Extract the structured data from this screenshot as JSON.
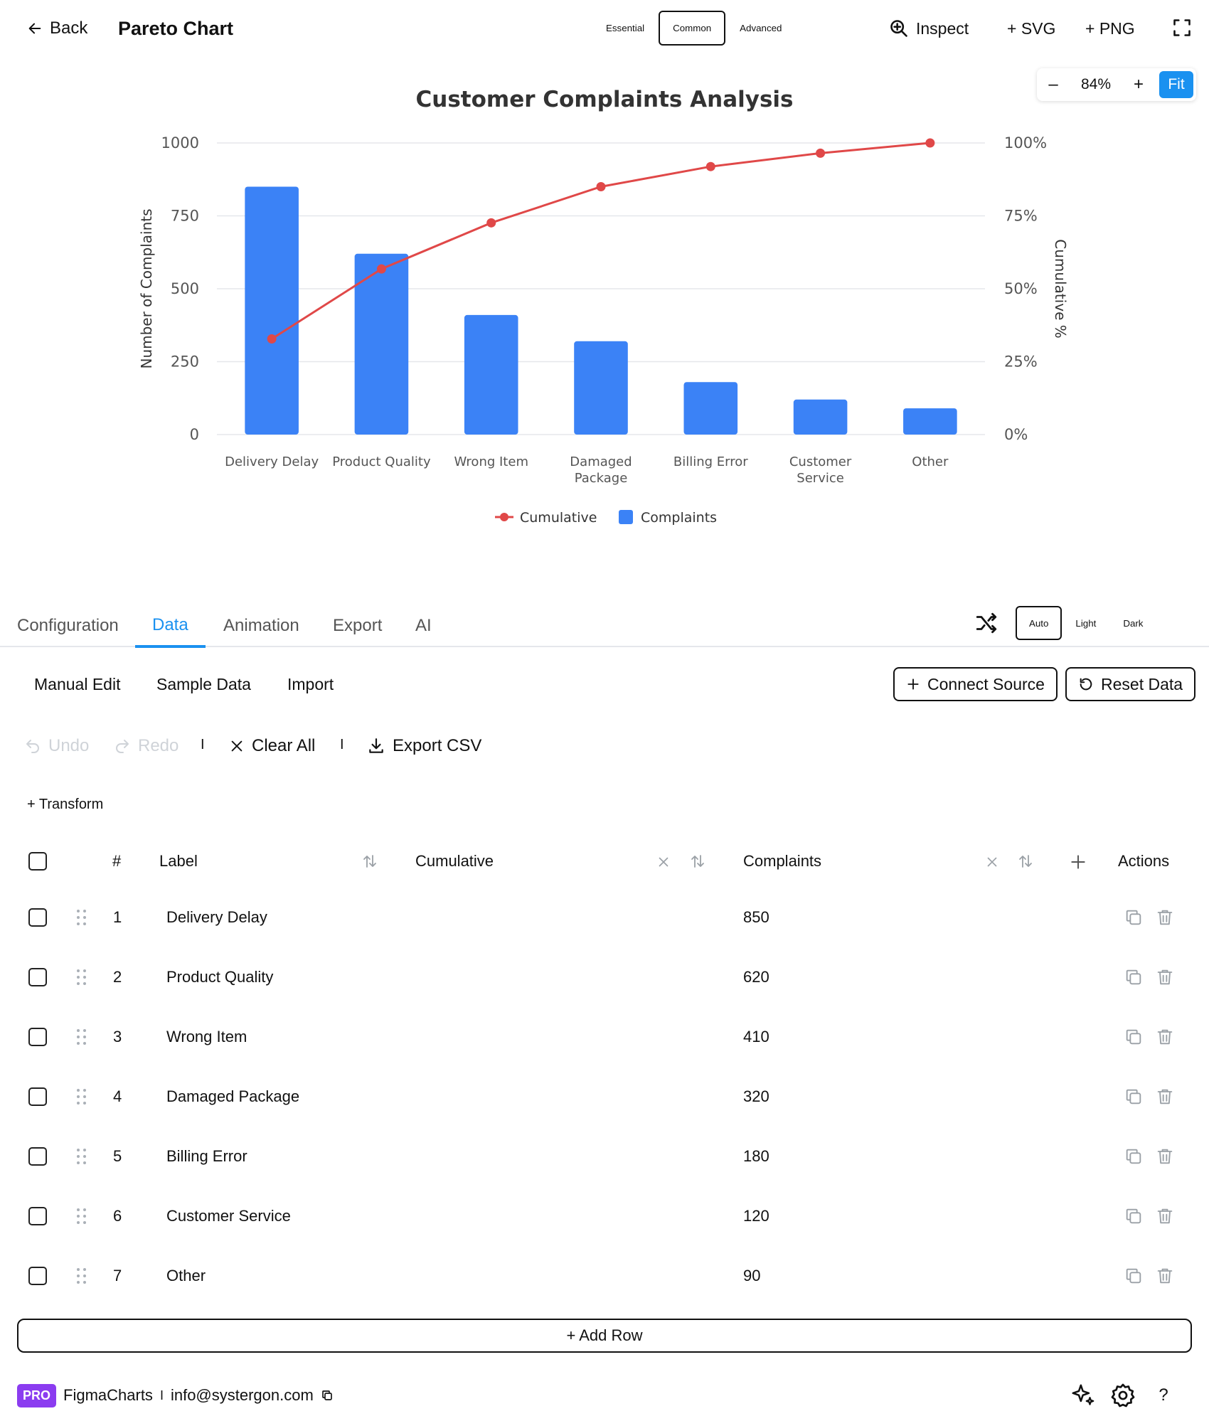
{
  "header": {
    "back_label": "Back",
    "title": "Pareto Chart",
    "segments": [
      {
        "label": "Essential",
        "active": false
      },
      {
        "label": "Common",
        "active": true
      },
      {
        "label": "Advanced",
        "active": false
      }
    ],
    "inspect_label": "Inspect",
    "svg_label": "+ SVG",
    "png_label": "+ PNG",
    "icons": {
      "back": "arrow-left-icon",
      "inspect": "zoom-in-icon",
      "fullscreen": "fullscreen-icon"
    }
  },
  "zoom": {
    "minus": "–",
    "value": "84%",
    "plus": "+",
    "fit": "Fit"
  },
  "chart_data": {
    "type": "bar",
    "title": "Customer Complaints Analysis",
    "categories": [
      "Delivery Delay",
      "Product Quality",
      "Wrong Item",
      "Damaged Package",
      "Billing Error",
      "Customer Service",
      "Other"
    ],
    "category_lines": [
      [
        "Delivery Delay"
      ],
      [
        "Product Quality"
      ],
      [
        "Wrong Item"
      ],
      [
        "Damaged",
        "Package"
      ],
      [
        "Billing Error"
      ],
      [
        "Customer",
        "Service"
      ],
      [
        "Other"
      ]
    ],
    "series": [
      {
        "name": "Complaints",
        "kind": "bar",
        "axis": "left",
        "values": [
          850,
          620,
          410,
          320,
          180,
          120,
          90
        ]
      },
      {
        "name": "Cumulative",
        "kind": "line",
        "axis": "right",
        "values": [
          32.8,
          56.8,
          72.6,
          85.0,
          91.9,
          96.5,
          100
        ]
      }
    ],
    "ylabel": "Number of Complaints",
    "y2label": "Cumulative %",
    "ylim": [
      0,
      1000
    ],
    "y2lim": [
      0,
      100
    ],
    "yticks": [
      "0",
      "250",
      "500",
      "750",
      "1000"
    ],
    "y2ticks": [
      "0%",
      "25%",
      "50%",
      "75%",
      "100%"
    ],
    "grid": true,
    "legend": "bottom",
    "legend_entries": [
      "Cumulative",
      "Complaints"
    ],
    "colors": {
      "bar": "#3b82f6",
      "line": "#e04848",
      "grid": "#e5e7eb",
      "text": "#555555"
    }
  },
  "tabs": [
    {
      "label": "Configuration",
      "active": false
    },
    {
      "label": "Data",
      "active": true
    },
    {
      "label": "Animation",
      "active": false
    },
    {
      "label": "Export",
      "active": false
    },
    {
      "label": "AI",
      "active": false
    }
  ],
  "theme": [
    {
      "label": "Auto",
      "active": true
    },
    {
      "label": "Light",
      "active": false
    },
    {
      "label": "Dark",
      "active": false
    }
  ],
  "data_panel": {
    "manual_edit": "Manual Edit",
    "sample_data": "Sample Data",
    "import": "Import",
    "connect_source": "Connect Source",
    "reset_data": "Reset Data",
    "undo": "Undo",
    "redo": "Redo",
    "separator": "I",
    "clear_all": "Clear All",
    "export_csv": "Export CSV",
    "transform": "+ Transform",
    "add_row": "+ Add Row"
  },
  "table": {
    "headers": {
      "index": "#",
      "label": "Label",
      "cumulative": "Cumulative",
      "complaints": "Complaints",
      "actions": "Actions"
    },
    "rows": [
      {
        "index": "1",
        "label": "Delivery Delay",
        "cumulative": "",
        "complaints": "850"
      },
      {
        "index": "2",
        "label": "Product Quality",
        "cumulative": "",
        "complaints": "620"
      },
      {
        "index": "3",
        "label": "Wrong Item",
        "cumulative": "",
        "complaints": "410"
      },
      {
        "index": "4",
        "label": "Damaged Package",
        "cumulative": "",
        "complaints": "320"
      },
      {
        "index": "5",
        "label": "Billing Error",
        "cumulative": "",
        "complaints": "180"
      },
      {
        "index": "6",
        "label": "Customer Service",
        "cumulative": "",
        "complaints": "120"
      },
      {
        "index": "7",
        "label": "Other",
        "cumulative": "",
        "complaints": "90"
      }
    ]
  },
  "footer": {
    "badge": "PRO",
    "brand": "FigmaCharts",
    "separator": "I",
    "email": "info@systergon.com"
  },
  "colors": {
    "accent": "#1a91f0",
    "pro_badge": "#8b3cf0"
  }
}
